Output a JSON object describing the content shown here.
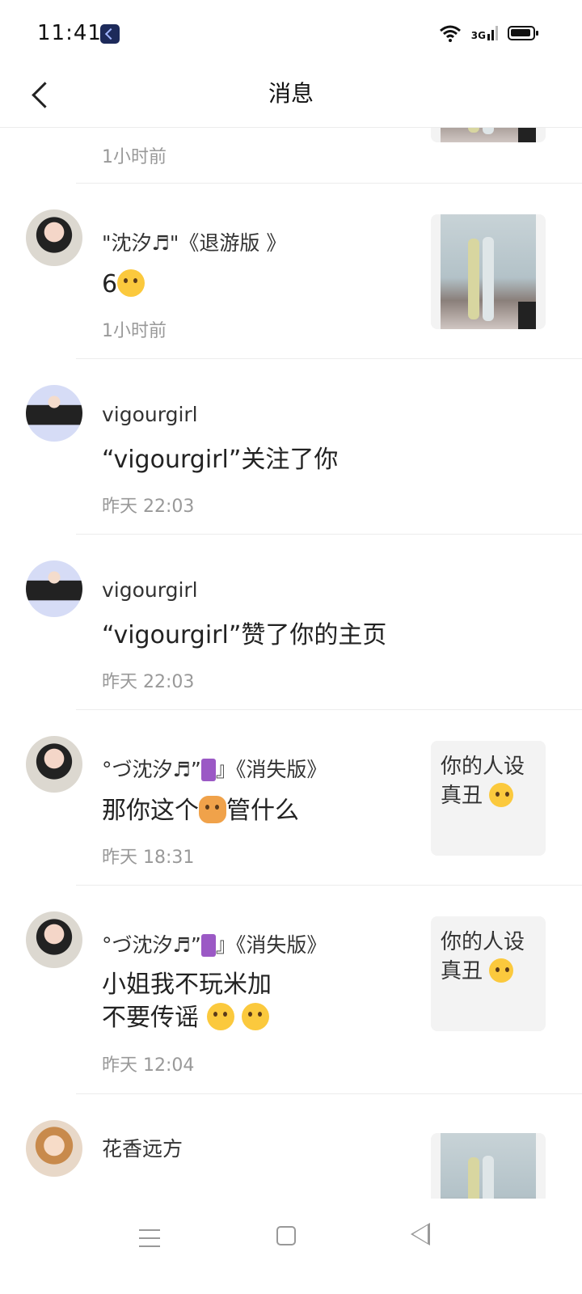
{
  "status": {
    "time": "11:41",
    "network": "3G"
  },
  "header": {
    "title": "消息"
  },
  "items": [
    {
      "time": "1小时前"
    },
    {
      "name": "\"沈汐♬\"《退游版 》",
      "message": "6",
      "time": "1小时前"
    },
    {
      "name": "vigourgirl",
      "message": "“vigourgirl”关注了你",
      "time": "昨天 22:03"
    },
    {
      "name": "vigourgirl",
      "message": "“vigourgirl”赞了你的主页",
      "time": "昨天 22:03"
    },
    {
      "name": "°づ沈汐♬”",
      "name_suffix": "』《消失版》",
      "message_a": "那你这个",
      "message_b": "管什么",
      "time": "昨天 18:31",
      "thumb_text": "你的人设真丑"
    },
    {
      "name": "°づ沈汐♬”",
      "name_suffix": "』《消失版》",
      "message_line1": "小姐我不玩米加",
      "message_line2": "不要传谣 ",
      "time": "昨天 12:04",
      "thumb_text": "你的人设真丑"
    },
    {
      "name": "花香远方"
    }
  ],
  "icons": {
    "back": "chevron-left-icon",
    "menu": "menu-icon",
    "home": "home-square-icon",
    "nav_back": "triangle-back-icon"
  }
}
